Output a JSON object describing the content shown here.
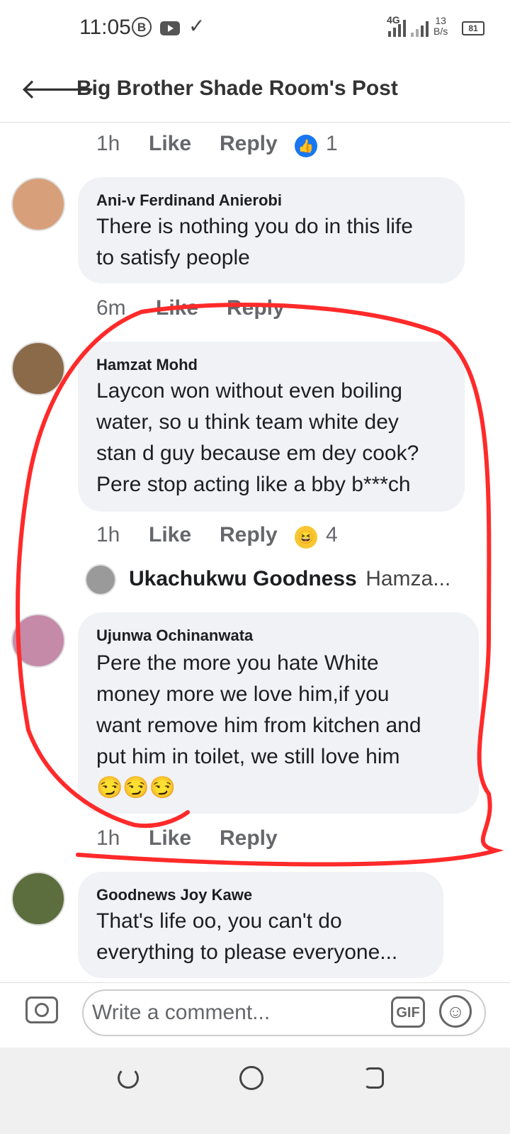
{
  "status_bar": {
    "time": "11:05",
    "b_icon": "B",
    "network": "4G",
    "speed_value": "13",
    "speed_unit": "B/s",
    "battery": "81"
  },
  "header": {
    "title": "Big Brother Shade Room's Post"
  },
  "top_meta": {
    "time": "1h",
    "like": "Like",
    "reply": "Reply",
    "reaction_count": "1"
  },
  "comments": [
    {
      "author": "Ani-v Ferdinand Anierobi",
      "lines": [
        "There is nothing you do in this life",
        "to satisfy people"
      ],
      "time": "6m",
      "like": "Like",
      "reply": "Reply"
    },
    {
      "author": "Hamzat Mohd",
      "lines": [
        "Laycon won without even boiling",
        "water, so u think team white dey",
        "stan d guy because em dey cook?",
        "Pere stop acting like a bby b***ch"
      ],
      "time": "1h",
      "like": "Like",
      "reply": "Reply",
      "reaction_count": "4",
      "reply_preview": {
        "author": "Ukachukwu Goodness",
        "snippet": "Hamza..."
      }
    },
    {
      "author": "Ujunwa Ochinanwata",
      "lines": [
        "Pere the more you hate White",
        "money more we love him,if you",
        "want remove him from kitchen and",
        "put  him in  toilet, we still love him",
        "😏😏😏"
      ],
      "time": "1h",
      "like": "Like",
      "reply": "Reply"
    },
    {
      "author": "Goodnews Joy Kawe",
      "lines": [
        "That's life oo, you can't do",
        "everything to please everyone..."
      ]
    }
  ],
  "composer": {
    "placeholder": "Write a comment...",
    "gif_label": "GIF"
  },
  "colors": {
    "annotation_red": "#ff2a2a",
    "bubble_bg": "#f0f2f5",
    "like_blue": "#1877f2",
    "meta_gray": "#65676b"
  }
}
